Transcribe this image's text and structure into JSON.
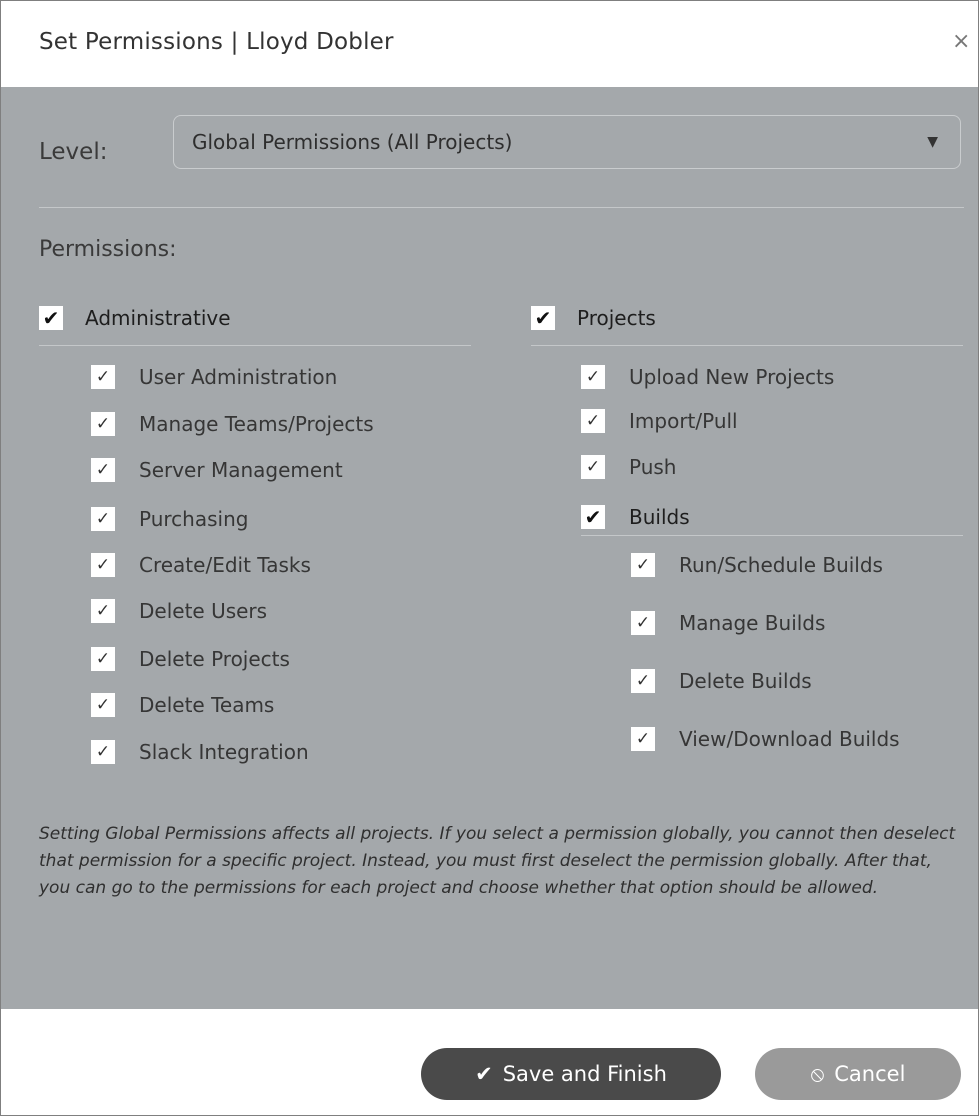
{
  "dialog": {
    "title": "Set Permissions | Lloyd Dobler",
    "close_icon": "×"
  },
  "level": {
    "label": "Level:",
    "selected": "Global Permissions (All Projects)",
    "arrow": "▼"
  },
  "permissions_label": "Permissions:",
  "administrative": {
    "label": "Administrative",
    "checked": true,
    "items": [
      {
        "label": "User Administration",
        "checked": true
      },
      {
        "label": "Manage Teams/Projects",
        "checked": true
      },
      {
        "label": "Server Management",
        "checked": true
      },
      {
        "label": "Purchasing",
        "checked": true
      },
      {
        "label": "Create/Edit Tasks",
        "checked": true
      },
      {
        "label": "Delete Users",
        "checked": true
      },
      {
        "label": "Delete Projects",
        "checked": true
      },
      {
        "label": "Delete Teams",
        "checked": true
      },
      {
        "label": "Slack Integration",
        "checked": true
      }
    ]
  },
  "projects": {
    "label": "Projects",
    "checked": true,
    "items": [
      {
        "label": "Upload New Projects",
        "checked": true
      },
      {
        "label": "Import/Pull",
        "checked": true
      },
      {
        "label": "Push",
        "checked": true
      }
    ],
    "builds": {
      "label": "Builds",
      "checked": true,
      "items": [
        {
          "label": "Run/Schedule Builds",
          "checked": true
        },
        {
          "label": "Manage Builds",
          "checked": true
        },
        {
          "label": "Delete Builds",
          "checked": true
        },
        {
          "label": "View/Download Builds",
          "checked": true
        }
      ]
    }
  },
  "note": "Setting Global Permissions affects all projects. If you select a permission globally, you cannot then deselect that permission for a specific project. Instead, you must first deselect the permission globally. After that, you can go to the permissions for each project and choose whether that option should be allowed.",
  "buttons": {
    "save_label": "Save and Finish",
    "save_icon": "✔",
    "cancel_label": "Cancel",
    "cancel_icon": "⦸"
  },
  "marks": {
    "light": "✓",
    "bold": "✔"
  },
  "colors": {
    "body_bg": "#a4a8ab",
    "save_button": "#4a4a4a",
    "cancel_button": "#9a9a9a"
  }
}
